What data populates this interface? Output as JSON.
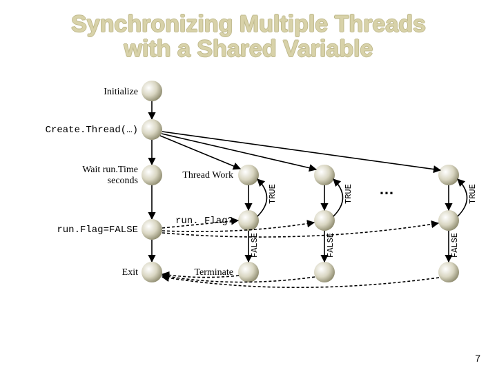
{
  "title_line1": "Synchronizing Multiple Threads",
  "title_line2": "with a Shared Variable",
  "labels": {
    "initialize": "Initialize",
    "create_thread": "Create.Thread(…)",
    "wait_runtime_l1": "Wait run.Time",
    "wait_runtime_l2": "seconds",
    "runflag_eq_false": "run.Flag=FALSE",
    "exit": "Exit",
    "thread_work": "Thread Work",
    "runflag_q": "run. Flag?",
    "terminate": "Terminate"
  },
  "edge_labels": {
    "true": "TRUE",
    "false": "FALSE"
  },
  "ellipsis": "…",
  "page_number": "7"
}
